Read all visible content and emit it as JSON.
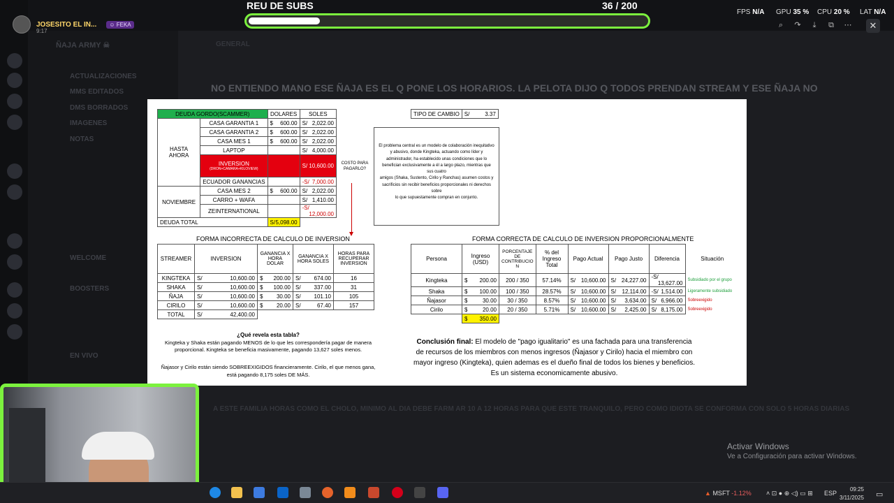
{
  "overlay": {
    "streamer_name": "JOSESITO EL IN...",
    "streamer_badge": "FEKA",
    "stream_time": "9:17",
    "subs_goal_title": "REU DE SUBS",
    "subs_goal_count": "36  / 200",
    "subs_goal_progress": 0.18,
    "fps_label": "FPS",
    "fps_value": "N/A",
    "gpu_label": "GPU",
    "gpu_value": "35 %",
    "cpu_label": "CPU",
    "cpu_value": "20 %",
    "lat_label": "LAT",
    "lat_value": "N/A"
  },
  "colors": {
    "accent": "#7cf23e",
    "sheet_green": "#1faf4d",
    "sheet_red": "#e4000f",
    "sheet_yellow": "#fff200"
  },
  "image_viewer": {
    "icons": [
      "zoom-icon",
      "rotate-icon",
      "download-icon",
      "open-external-icon",
      "more-icon"
    ],
    "close": "✕"
  },
  "discord_bg": {
    "server_name": "ÑAJA ARMY ☠",
    "channel_title": "GENERAL",
    "channels": [
      "ACTUALIZACIONES",
      "MMS EDITADOS",
      "DMS BORRADOS",
      "IMAGENES",
      "NOTAS",
      "WELCOME",
      "BOOSTERS",
      "EN VIVO"
    ],
    "big_message": "NO ENTIENDO MANO ESE ÑAJA ES EL Q PONE LOS HORARIOS. LA PELOTA DIJO Q TODOS PRENDAN STREAM Y ESE ÑAJA NO",
    "message2": "A ESTE FAMILIA HORAS COMO EL CHOLO, MINIMO AL DIA DEBE FARM AR 10 A 12 HORAS PARA QUE ESTE TRANQUILO, PERO COMO IDIOTA SE CONFORMA CON SOLO 5 HORAS DIARIAS"
  },
  "sheet": {
    "debt_table": {
      "header": [
        "DEUDA GORDO(SCAMMER)",
        "DOLARES",
        "SOLES"
      ],
      "group1": "HASTA AHORA",
      "group2": "NOVIEMBRE",
      "rows": [
        {
          "item": "CASA GARANTIA 1",
          "usd_sym": "$",
          "usd": "600.00",
          "pen_sym": "S/",
          "pen": "2,022.00"
        },
        {
          "item": "CASA GARANTIA 2",
          "usd_sym": "$",
          "usd": "600.00",
          "pen_sym": "S/",
          "pen": "2,022.00"
        },
        {
          "item": "CASA MES 1",
          "usd_sym": "$",
          "usd": "600.00",
          "pen_sym": "S/",
          "pen": "2,022.00"
        },
        {
          "item": "LAPTOP",
          "usd_sym": "",
          "usd": "",
          "pen_sym": "S/",
          "pen": "4,000.00"
        },
        {
          "item": "INVERSION",
          "sub": "(DRON+CAMARA+KILOVIEW)",
          "usd_sym": "",
          "usd": "",
          "pen_sym": "S/",
          "pen": "10,600.00"
        },
        {
          "item": "ECUADOR GANANCIAS",
          "usd_sym": "",
          "usd": "",
          "pen_sym": "-S/",
          "pen": "7,000.00"
        },
        {
          "item": "CASA MES 2",
          "usd_sym": "$",
          "usd": "600.00",
          "pen_sym": "S/",
          "pen": "2,022.00"
        },
        {
          "item": "CARRO + WAFA",
          "usd_sym": "",
          "usd": "",
          "pen_sym": "S/",
          "pen": "1,410.00"
        },
        {
          "item": "ZEINTERNATIONAL",
          "usd_sym": "",
          "usd": "",
          "pen_sym": "-S/",
          "pen": "12,000.00"
        }
      ],
      "total_label": "DEUDA TOTAL",
      "total_sym": "S/",
      "total_value": "5,098.00"
    },
    "exchange": {
      "label": "TIPO DE CAMBIO",
      "sym": "S/",
      "value": "3.37"
    },
    "costo_label": "COSTO PARA PAGARLO?",
    "description": [
      "El problema central es un modelo de colaboración inequitativo y abusivo, donde Kingteka, actuando como líder y",
      "administrador, ha establecido unas condiciones que lo benefician exclusivamente a él a largo plazo, mientras que sus cuatro",
      "amigos (Shaka, Sustento, Cirilo y Ranchas) asumen costos y sacrificios sin recibir beneficios proporcionales ni derechos sobre",
      "lo que supuestamente compran en conjunto."
    ],
    "incorrect": {
      "title": "FORMA INCORRECTA DE CALCULO DE INVERSION",
      "headers": [
        "STREAMER",
        "INVERSION",
        "GANANCIA X HORA DOLAR",
        "GANANCIA X HORA SOLES",
        "HORAS PARA RECUPERAR INVERSION"
      ],
      "rows": [
        {
          "name": "KINGTEKA",
          "inv": "10,600.00",
          "usd": "200.00",
          "pen": "674.00",
          "hrs": "16"
        },
        {
          "name": "SHAKA",
          "inv": "10,600.00",
          "usd": "100.00",
          "pen": "337.00",
          "hrs": "31"
        },
        {
          "name": "ÑAJA",
          "inv": "10,600.00",
          "usd": "30.00",
          "pen": "101.10",
          "hrs": "105"
        },
        {
          "name": "CIRILO",
          "inv": "10,600.00",
          "usd": "20.00",
          "pen": "67.40",
          "hrs": "157"
        }
      ],
      "total_label": "TOTAL",
      "total_value": "42,400.00"
    },
    "correct": {
      "title": "FORMA CORRECTA DE CALCULO DE INVERSION PROPORCIONALMENTE",
      "headers": [
        "Persona",
        "Ingreso (USD)",
        "PORCENTAJE DE CONTRIBUCIO N",
        "% del Ingreso Total",
        "Pago Actual",
        "Pago Justo",
        "Diferencia",
        "Situación"
      ],
      "rows": [
        {
          "name": "Kingteka",
          "inc": "200.00",
          "pct": "200 / 350",
          "share": "57.14%",
          "actual": "10,600.00",
          "fair": "24,227.00",
          "diff_sym": "-S/",
          "diff": "13,627.00",
          "sit": "Subsidiado por el grupo",
          "sit_type": "green"
        },
        {
          "name": "Shaka",
          "inc": "100.00",
          "pct": "100 / 350",
          "share": "28.57%",
          "actual": "10,600.00",
          "fair": "12,114.00",
          "diff_sym": "-S/",
          "diff": "1,514.00",
          "sit": "Ligeramente subsidiado",
          "sit_type": "green"
        },
        {
          "name": "Ñajasor",
          "inc": "30.00",
          "pct": "30 / 350",
          "share": "8.57%",
          "actual": "10,600.00",
          "fair": "3,634.00",
          "diff_sym": "S/",
          "diff": "6,966.00",
          "sit": "Sobreexigido",
          "sit_type": "red"
        },
        {
          "name": "Cirilo",
          "inc": "20.00",
          "pct": "20 / 350",
          "share": "5.71%",
          "actual": "10,600.00",
          "fair": "2,425.00",
          "diff_sym": "S/",
          "diff": "8,175.00",
          "sit": "Sobreexigido",
          "sit_type": "red"
        }
      ],
      "total_income": "350.00"
    },
    "notes": {
      "question": "¿Qué revela esta tabla?",
      "p1": "Kingteka y Shaka están pagando MENOS de lo que les correspondería pagar de manera proporcional. Kingteka se beneficia masivamente, pagando 13,627 soles menos.",
      "p2": "Ñajasor y Cirilo están siendo SOBREEXIGIDOS financieramente. Cirilo, el que menos gana, está pagando 8,175 soles DE MÁS."
    },
    "conclusion_label": "Conclusión final:",
    "conclusion_text": " El modelo de \"pago igualitario\" es una fachada para una transferencia de recursos de los miembros con menos ingresos (Ñajasor y Cirilo) hacia el miembro con mayor ingreso (Kingteka), quien ademas es el dueño final de todos los bienes y beneficios. Es un sistema economicamente abusivo."
  },
  "windows_watermark": {
    "line1": "Activar Windows",
    "line2": "Ve a Configuración para activar Windows."
  },
  "taskbar": {
    "stock_name": "MSFT",
    "stock_change": "-1.12%",
    "lang": "ESP",
    "time": "09:25",
    "date": "3/11/2025"
  }
}
